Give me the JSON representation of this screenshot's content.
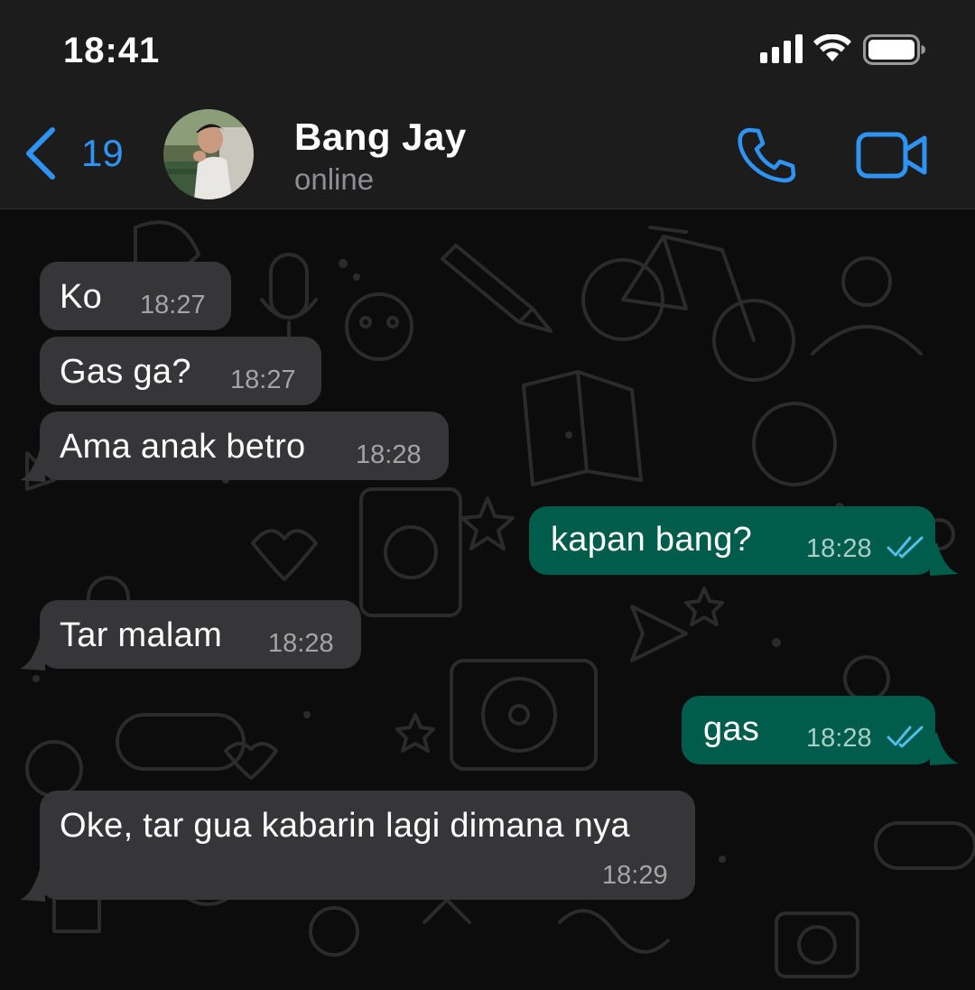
{
  "status_bar": {
    "time": "18:41",
    "icons": [
      "cellular-signal-icon",
      "wifi-icon",
      "battery-icon"
    ]
  },
  "header": {
    "back_count": "19",
    "contact_name": "Bang Jay",
    "contact_status": "online",
    "icons": [
      "back-chevron-icon",
      "phone-call-icon",
      "video-call-icon"
    ]
  },
  "messages": [
    {
      "direction": "incoming",
      "text": "Ko",
      "time": "18:27"
    },
    {
      "direction": "incoming",
      "text": "Gas ga?",
      "time": "18:27"
    },
    {
      "direction": "incoming",
      "text": "Ama anak betro",
      "time": "18:28"
    },
    {
      "direction": "outgoing",
      "text": "kapan bang?",
      "time": "18:28",
      "status": "read"
    },
    {
      "direction": "incoming",
      "text": "Tar malam",
      "time": "18:28"
    },
    {
      "direction": "outgoing",
      "text": "gas",
      "time": "18:28",
      "status": "read"
    },
    {
      "direction": "incoming",
      "text": "Oke, tar gua kabarin lagi dimana nya",
      "time": "18:29"
    }
  ],
  "colors": {
    "accent": "#2f93f4",
    "incoming_bubble": "#363638",
    "outgoing_bubble": "#005c4b",
    "read_ticks": "#53bdeb",
    "header_bg": "#1c1c1c",
    "chat_bg": "#0c0c0c"
  }
}
